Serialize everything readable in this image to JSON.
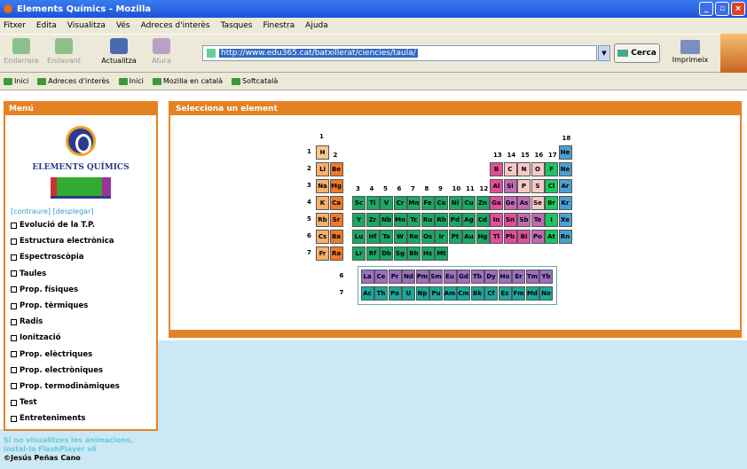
{
  "window": {
    "title": "Elements Químics - Mozilla",
    "controls": [
      "_",
      "▫",
      "×"
    ]
  },
  "menu": [
    "Fitxer",
    "Edita",
    "Visualitza",
    "Vés",
    "Adreces d'interès",
    "Tasques",
    "Finestra",
    "Ajuda"
  ],
  "nav": {
    "back": "Endarrere",
    "forward": "Endavant",
    "reload": "Actualitza",
    "stop": "Atura",
    "url": "http://www.edu365.cat/batxillerat/ciencies/taula/",
    "search": "Cerca",
    "print": "Imprimeix"
  },
  "bookmarks": [
    "Inici",
    "Adreces d'interès",
    "Inici",
    "Mozilla en català",
    "Softcatalà"
  ],
  "sidebar": {
    "header": "Menú",
    "logo_text": "ELEMENTS QUÍMICS",
    "expand": "[contraure]  [desplegar]",
    "items": [
      "Evolució de la T.P.",
      "Estructura electrònica",
      "Espectroscòpia",
      "Taules",
      "Prop. físiques",
      "Prop. tèrmiques",
      "Radis",
      "Ionització",
      "Prop. elèctriques",
      "Prop. electròniques",
      "Prop. termodinàmiques",
      "Test",
      "Entreteniments"
    ],
    "note": "Si no visualitzes les animacions, instal·la FlashPlayer v6",
    "copyright": "©Jesús Peñas Cano"
  },
  "main": {
    "header": "Selecciona un element"
  },
  "colors": {
    "s_alkali": "#f5b06a",
    "s_alkaline": "#f07a28",
    "hydrogen": "#f5c890",
    "transition": "#1aa867",
    "lanthanide": "#9b6fc4",
    "actinide": "#1aa89a",
    "metal_post": "#e04f9a",
    "metalloid": "#c06ab8",
    "nonmetal": "#f8c8c8",
    "halogen": "#1ac860",
    "noble": "#4aa0d0"
  },
  "groups": [
    "1",
    "2",
    "3",
    "4",
    "5",
    "6",
    "7",
    "8",
    "9",
    "10",
    "11",
    "12",
    "13",
    "14",
    "15",
    "16",
    "17",
    "18"
  ],
  "periods": [
    "1",
    "2",
    "3",
    "4",
    "5",
    "6",
    "7"
  ],
  "fblock_labels": [
    "6",
    "7"
  ],
  "elements": [
    {
      "s": "H",
      "g": 1,
      "p": 1,
      "c": "hydrogen"
    },
    {
      "s": "He",
      "g": 18,
      "p": 1,
      "c": "noble"
    },
    {
      "s": "Li",
      "g": 1,
      "p": 2,
      "c": "s_alkali"
    },
    {
      "s": "Be",
      "g": 2,
      "p": 2,
      "c": "s_alkaline"
    },
    {
      "s": "B",
      "g": 13,
      "p": 2,
      "c": "metal_post"
    },
    {
      "s": "C",
      "g": 14,
      "p": 2,
      "c": "nonmetal"
    },
    {
      "s": "N",
      "g": 15,
      "p": 2,
      "c": "nonmetal"
    },
    {
      "s": "O",
      "g": 16,
      "p": 2,
      "c": "nonmetal"
    },
    {
      "s": "F",
      "g": 17,
      "p": 2,
      "c": "halogen"
    },
    {
      "s": "Ne",
      "g": 18,
      "p": 2,
      "c": "noble"
    },
    {
      "s": "Na",
      "g": 1,
      "p": 3,
      "c": "s_alkali"
    },
    {
      "s": "Mg",
      "g": 2,
      "p": 3,
      "c": "s_alkaline"
    },
    {
      "s": "Al",
      "g": 13,
      "p": 3,
      "c": "metal_post"
    },
    {
      "s": "Si",
      "g": 14,
      "p": 3,
      "c": "metalloid"
    },
    {
      "s": "P",
      "g": 15,
      "p": 3,
      "c": "nonmetal"
    },
    {
      "s": "S",
      "g": 16,
      "p": 3,
      "c": "nonmetal"
    },
    {
      "s": "Cl",
      "g": 17,
      "p": 3,
      "c": "halogen"
    },
    {
      "s": "Ar",
      "g": 18,
      "p": 3,
      "c": "noble"
    },
    {
      "s": "K",
      "g": 1,
      "p": 4,
      "c": "s_alkali"
    },
    {
      "s": "Ca",
      "g": 2,
      "p": 4,
      "c": "s_alkaline"
    },
    {
      "s": "Sc",
      "g": 3,
      "p": 4,
      "c": "transition"
    },
    {
      "s": "Ti",
      "g": 4,
      "p": 4,
      "c": "transition"
    },
    {
      "s": "V",
      "g": 5,
      "p": 4,
      "c": "transition"
    },
    {
      "s": "Cr",
      "g": 6,
      "p": 4,
      "c": "transition"
    },
    {
      "s": "Mn",
      "g": 7,
      "p": 4,
      "c": "transition"
    },
    {
      "s": "Fe",
      "g": 8,
      "p": 4,
      "c": "transition"
    },
    {
      "s": "Co",
      "g": 9,
      "p": 4,
      "c": "transition"
    },
    {
      "s": "Ni",
      "g": 10,
      "p": 4,
      "c": "transition"
    },
    {
      "s": "Cu",
      "g": 11,
      "p": 4,
      "c": "transition"
    },
    {
      "s": "Zn",
      "g": 12,
      "p": 4,
      "c": "transition"
    },
    {
      "s": "Ga",
      "g": 13,
      "p": 4,
      "c": "metal_post"
    },
    {
      "s": "Ge",
      "g": 14,
      "p": 4,
      "c": "metalloid"
    },
    {
      "s": "As",
      "g": 15,
      "p": 4,
      "c": "metalloid"
    },
    {
      "s": "Se",
      "g": 16,
      "p": 4,
      "c": "nonmetal"
    },
    {
      "s": "Br",
      "g": 17,
      "p": 4,
      "c": "halogen"
    },
    {
      "s": "Kr",
      "g": 18,
      "p": 4,
      "c": "noble"
    },
    {
      "s": "Rb",
      "g": 1,
      "p": 5,
      "c": "s_alkali"
    },
    {
      "s": "Sr",
      "g": 2,
      "p": 5,
      "c": "s_alkaline"
    },
    {
      "s": "Y",
      "g": 3,
      "p": 5,
      "c": "transition"
    },
    {
      "s": "Zr",
      "g": 4,
      "p": 5,
      "c": "transition"
    },
    {
      "s": "Nb",
      "g": 5,
      "p": 5,
      "c": "transition"
    },
    {
      "s": "Mo",
      "g": 6,
      "p": 5,
      "c": "transition"
    },
    {
      "s": "Tc",
      "g": 7,
      "p": 5,
      "c": "transition"
    },
    {
      "s": "Ru",
      "g": 8,
      "p": 5,
      "c": "transition"
    },
    {
      "s": "Rh",
      "g": 9,
      "p": 5,
      "c": "transition"
    },
    {
      "s": "Pd",
      "g": 10,
      "p": 5,
      "c": "transition"
    },
    {
      "s": "Ag",
      "g": 11,
      "p": 5,
      "c": "transition"
    },
    {
      "s": "Cd",
      "g": 12,
      "p": 5,
      "c": "transition"
    },
    {
      "s": "In",
      "g": 13,
      "p": 5,
      "c": "metal_post"
    },
    {
      "s": "Sn",
      "g": 14,
      "p": 5,
      "c": "metal_post"
    },
    {
      "s": "Sb",
      "g": 15,
      "p": 5,
      "c": "metalloid"
    },
    {
      "s": "Te",
      "g": 16,
      "p": 5,
      "c": "metalloid"
    },
    {
      "s": "I",
      "g": 17,
      "p": 5,
      "c": "halogen"
    },
    {
      "s": "Xe",
      "g": 18,
      "p": 5,
      "c": "noble"
    },
    {
      "s": "Cs",
      "g": 1,
      "p": 6,
      "c": "s_alkali"
    },
    {
      "s": "Ba",
      "g": 2,
      "p": 6,
      "c": "s_alkaline"
    },
    {
      "s": "Lu",
      "g": 3,
      "p": 6,
      "c": "transition"
    },
    {
      "s": "Hf",
      "g": 4,
      "p": 6,
      "c": "transition"
    },
    {
      "s": "Ta",
      "g": 5,
      "p": 6,
      "c": "transition"
    },
    {
      "s": "W",
      "g": 6,
      "p": 6,
      "c": "transition"
    },
    {
      "s": "Re",
      "g": 7,
      "p": 6,
      "c": "transition"
    },
    {
      "s": "Os",
      "g": 8,
      "p": 6,
      "c": "transition"
    },
    {
      "s": "Ir",
      "g": 9,
      "p": 6,
      "c": "transition"
    },
    {
      "s": "Pt",
      "g": 10,
      "p": 6,
      "c": "transition"
    },
    {
      "s": "Au",
      "g": 11,
      "p": 6,
      "c": "transition"
    },
    {
      "s": "Hg",
      "g": 12,
      "p": 6,
      "c": "transition"
    },
    {
      "s": "Tl",
      "g": 13,
      "p": 6,
      "c": "metal_post"
    },
    {
      "s": "Pb",
      "g": 14,
      "p": 6,
      "c": "metal_post"
    },
    {
      "s": "Bi",
      "g": 15,
      "p": 6,
      "c": "metal_post"
    },
    {
      "s": "Po",
      "g": 16,
      "p": 6,
      "c": "metalloid"
    },
    {
      "s": "At",
      "g": 17,
      "p": 6,
      "c": "halogen"
    },
    {
      "s": "Rn",
      "g": 18,
      "p": 6,
      "c": "noble"
    },
    {
      "s": "Fr",
      "g": 1,
      "p": 7,
      "c": "s_alkali"
    },
    {
      "s": "Ra",
      "g": 2,
      "p": 7,
      "c": "s_alkaline"
    },
    {
      "s": "Lr",
      "g": 3,
      "p": 7,
      "c": "transition"
    },
    {
      "s": "Rf",
      "g": 4,
      "p": 7,
      "c": "transition"
    },
    {
      "s": "Db",
      "g": 5,
      "p": 7,
      "c": "transition"
    },
    {
      "s": "Sg",
      "g": 6,
      "p": 7,
      "c": "transition"
    },
    {
      "s": "Bh",
      "g": 7,
      "p": 7,
      "c": "transition"
    },
    {
      "s": "Hs",
      "g": 8,
      "p": 7,
      "c": "transition"
    },
    {
      "s": "Mt",
      "g": 9,
      "p": 7,
      "c": "transition"
    }
  ],
  "lanthanides": [
    "La",
    "Ce",
    "Pr",
    "Nd",
    "Pm",
    "Sm",
    "Eu",
    "Gd",
    "Tb",
    "Dy",
    "Ho",
    "Er",
    "Tm",
    "Yb"
  ],
  "actinides": [
    "Ac",
    "Th",
    "Pa",
    "U",
    "Np",
    "Pu",
    "Am",
    "Cm",
    "Bk",
    "Cf",
    "Es",
    "Fm",
    "Md",
    "No"
  ]
}
